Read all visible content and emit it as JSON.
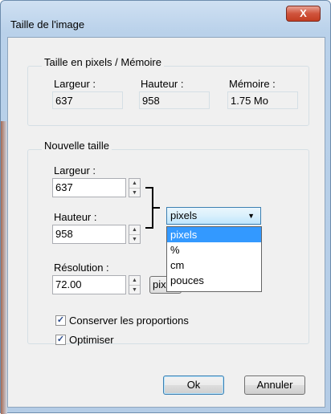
{
  "window": {
    "title": "Taille de l'image",
    "close_label": "X"
  },
  "memory_group": {
    "legend": "Taille en pixels / Mémoire",
    "width_label": "Largeur :",
    "width_value": "637",
    "height_label": "Hauteur :",
    "height_value": "958",
    "memory_label": "Mémoire :",
    "memory_value": "1.75 Mo"
  },
  "new_size_group": {
    "legend": "Nouvelle taille",
    "width_label": "Largeur :",
    "width_value": "637",
    "height_label": "Hauteur :",
    "height_value": "958",
    "resolution_label": "Résolution :",
    "resolution_value": "72.00",
    "unit_selected": "pixels",
    "unit_options": [
      "pixels",
      "%",
      "cm",
      "pouces"
    ],
    "resolution_unit_button": "pixels"
  },
  "options": {
    "keep_proportions_label": "Conserver les proportions",
    "keep_proportions_checked": true,
    "optimize_label": "Optimiser",
    "optimize_checked": true
  },
  "buttons": {
    "ok": "Ok",
    "cancel": "Annuler"
  },
  "icons": {
    "close": "close-icon",
    "dropdown": "chevron-down-icon",
    "spin_up": "spin-up-icon",
    "spin_down": "spin-down-icon",
    "check": "checkmark-icon"
  },
  "colors": {
    "selection": "#3399ff",
    "close_button": "#c33d22",
    "titlebar": "#b9d1ea"
  }
}
